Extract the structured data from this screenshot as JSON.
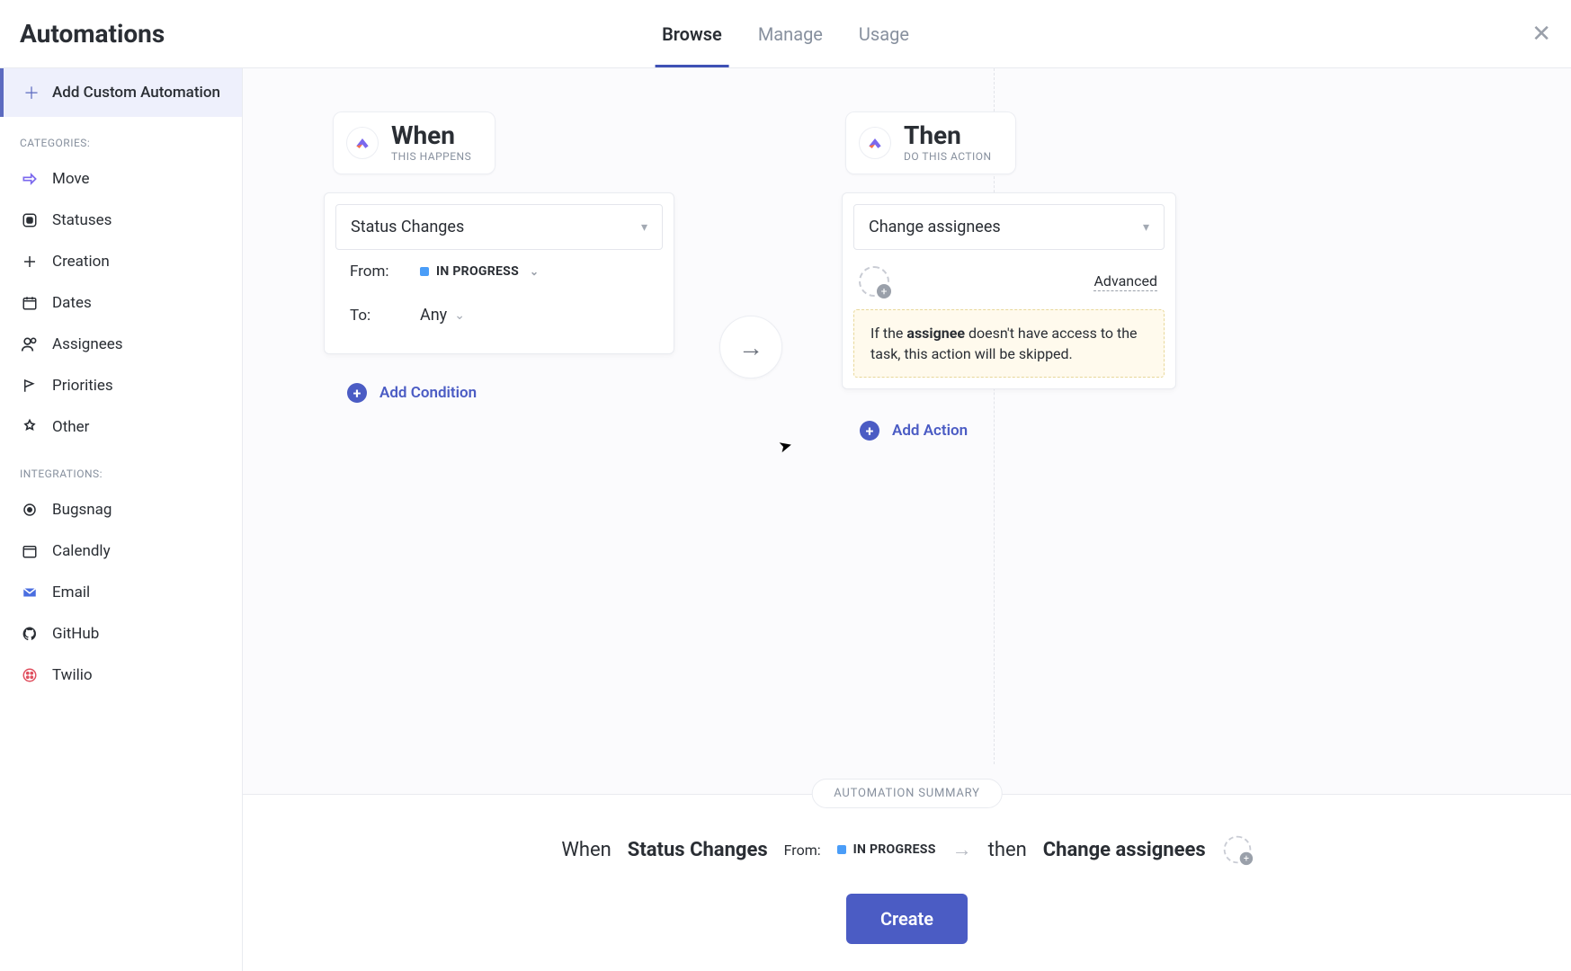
{
  "header": {
    "title": "Automations",
    "tabs": [
      "Browse",
      "Manage",
      "Usage"
    ],
    "active_tab": "Browse"
  },
  "sidebar": {
    "add_custom_label": "Add Custom Automation",
    "categories_label": "CATEGORIES:",
    "categories": [
      {
        "label": "Move",
        "icon": "move-icon"
      },
      {
        "label": "Statuses",
        "icon": "status-icon"
      },
      {
        "label": "Creation",
        "icon": "creation-icon"
      },
      {
        "label": "Dates",
        "icon": "dates-icon"
      },
      {
        "label": "Assignees",
        "icon": "assignees-icon"
      },
      {
        "label": "Priorities",
        "icon": "priorities-icon"
      },
      {
        "label": "Other",
        "icon": "other-icon"
      }
    ],
    "integrations_label": "INTEGRATIONS:",
    "integrations": [
      {
        "label": "Bugsnag",
        "icon": "bugsnag-icon"
      },
      {
        "label": "Calendly",
        "icon": "calendly-icon"
      },
      {
        "label": "Email",
        "icon": "email-icon"
      },
      {
        "label": "GitHub",
        "icon": "github-icon"
      },
      {
        "label": "Twilio",
        "icon": "twilio-icon"
      }
    ]
  },
  "builder": {
    "when_title": "When",
    "when_sub": "THIS HAPPENS",
    "then_title": "Then",
    "then_sub": "DO THIS ACTION",
    "trigger_select": "Status Changes",
    "from_label": "From:",
    "from_value": "IN PROGRESS",
    "to_label": "To:",
    "to_value": "Any",
    "add_condition_label": "Add Condition",
    "action_select": "Change assignees",
    "advanced_label": "Advanced",
    "warning_prefix": "If the ",
    "warning_bold": "assignee",
    "warning_suffix": " doesn't have access to the task, this action will be skipped.",
    "add_action_label": "Add Action"
  },
  "summary": {
    "pill": "AUTOMATION SUMMARY",
    "when_word": "When",
    "when_event": "Status Changes",
    "from_label": "From:",
    "from_value": "IN PROGRESS",
    "then_word": "then",
    "then_action": "Change assignees",
    "create_label": "Create"
  },
  "colors": {
    "accent": "#4b5cc4",
    "status_blue": "#4a9df8"
  }
}
